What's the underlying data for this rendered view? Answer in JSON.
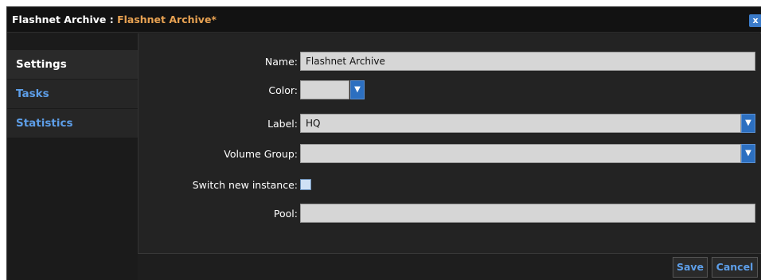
{
  "window": {
    "title_prefix": "Flashnet Archive : ",
    "title_name": "Flashnet Archive*",
    "close_glyph": "x"
  },
  "sidebar": {
    "items": [
      {
        "label": "Settings",
        "active": true
      },
      {
        "label": "Tasks",
        "active": false
      },
      {
        "label": "Statistics",
        "active": false
      }
    ]
  },
  "form": {
    "name_label": "Name:",
    "name_value": "Flashnet Archive",
    "color_label": "Color:",
    "color_value": "",
    "label_label": "Label:",
    "label_value": "HQ",
    "volume_group_label": "Volume Group:",
    "volume_group_value": "",
    "switch_label": "Switch new instance:",
    "switch_checked": false,
    "pool_label": "Pool:",
    "pool_value": ""
  },
  "footer": {
    "save_label": "Save",
    "cancel_label": "Cancel"
  },
  "icons": {
    "dropdown": "chevron-down-icon",
    "close": "close-icon"
  },
  "colors": {
    "accent_link": "#5d9ee8",
    "title_accent": "#e8a252",
    "dropdown_button": "#2c6fc0"
  }
}
